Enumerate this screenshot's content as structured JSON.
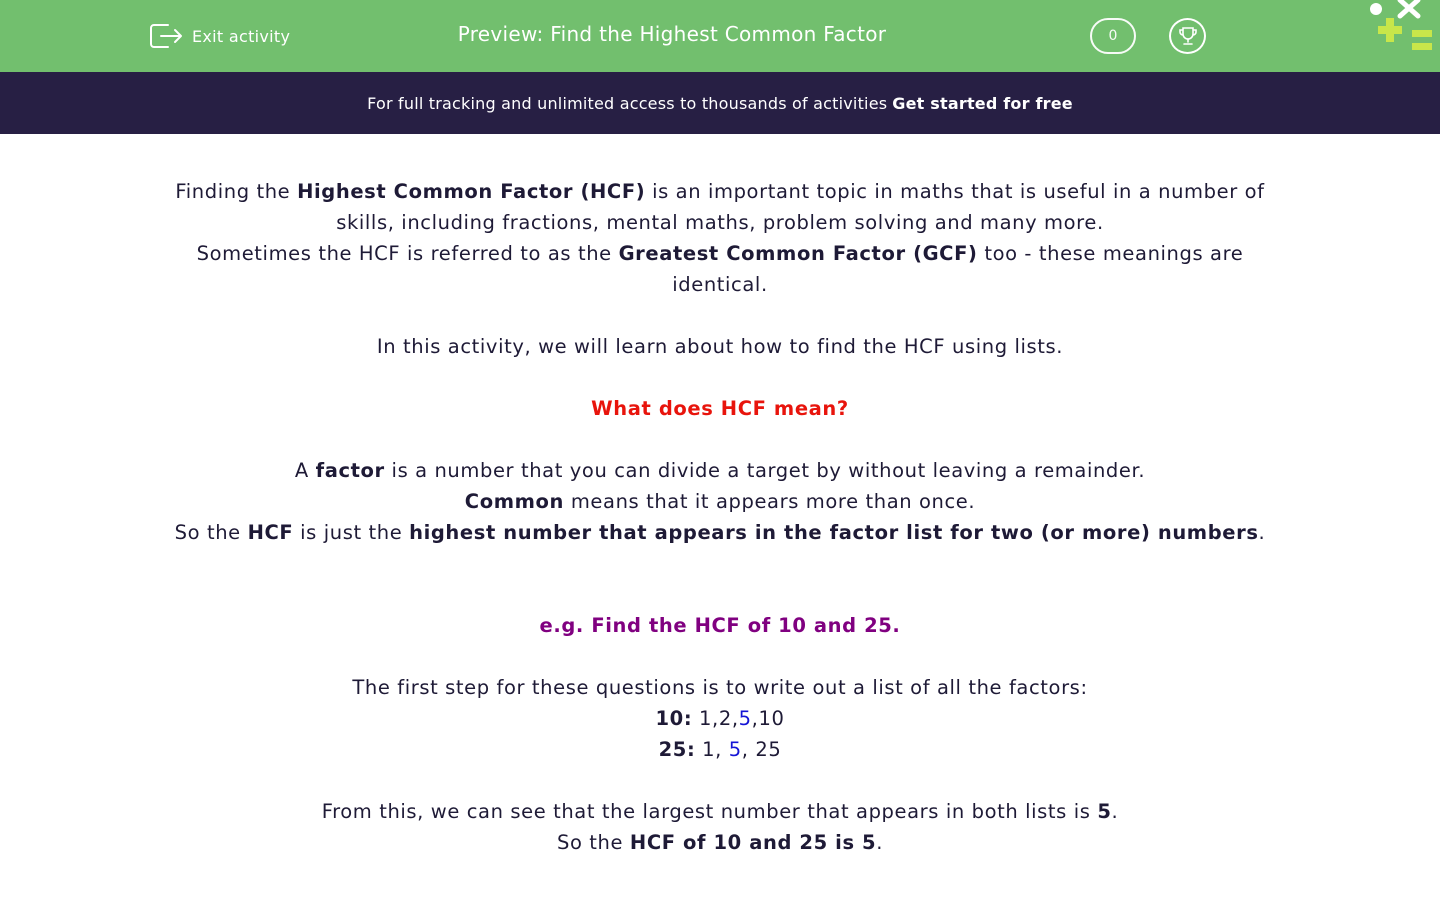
{
  "header": {
    "exit_label": "Exit activity",
    "title": "Preview: Find the Highest Common Factor",
    "score": "0"
  },
  "promo": {
    "text": "For full tracking and unlimited access to thousands of activities",
    "cta": "Get started for free"
  },
  "intro": {
    "p1_a": "Finding the ",
    "p1_b": "Highest Common Factor (HCF)",
    "p1_c": " is an important topic in maths that is useful in a number of skills, including fractions, mental maths, problem solving and many more.",
    "p2_a": "Sometimes the HCF is referred to as the ",
    "p2_b": "Greatest Common Factor (GCF)",
    "p2_c": " too - these meanings are identical.",
    "p3": "In this activity, we will learn about how to find the HCF using lists."
  },
  "meaning": {
    "heading": "What does HCF mean?",
    "l1_a": "A ",
    "l1_b": "factor",
    "l1_c": " is a number that you can divide a target by without leaving a remainder.",
    "l2_a": "Common",
    "l2_b": " means that it appears more than once.",
    "l3_a": "So the ",
    "l3_b": "HCF",
    "l3_c": " is just the ",
    "l3_d": "highest number that appears in the factor list for two (or more) numbers",
    "l3_e": "."
  },
  "example": {
    "heading": "e.g. Find the HCF of 10 and 25.",
    "step": "The first step for these questions is to write out a list of all the factors:",
    "list1_label": "10:",
    "list1_a": " 1,2,",
    "list1_hl": "5",
    "list1_b": ",10",
    "list2_label": "25:",
    "list2_a": " 1, ",
    "list2_hl": "5",
    "list2_b": ", 25",
    "c1_a": "From this, we can see that the largest number that appears in both lists is ",
    "c1_b": "5",
    "c1_c": ".",
    "c2_a": "So the ",
    "c2_b": "HCF of 10 and 25 is 5",
    "c2_c": "."
  },
  "colors": {
    "header_bg": "#72bf6e",
    "promo_bg": "#271f44",
    "text": "#1e1a36",
    "heading_red": "#e8140c",
    "example_purple": "#800080",
    "highlight_blue": "#1515d6",
    "logo_lime": "#c8e64a"
  },
  "icons": [
    "exit-icon",
    "trophy-icon",
    "logo-icon"
  ]
}
